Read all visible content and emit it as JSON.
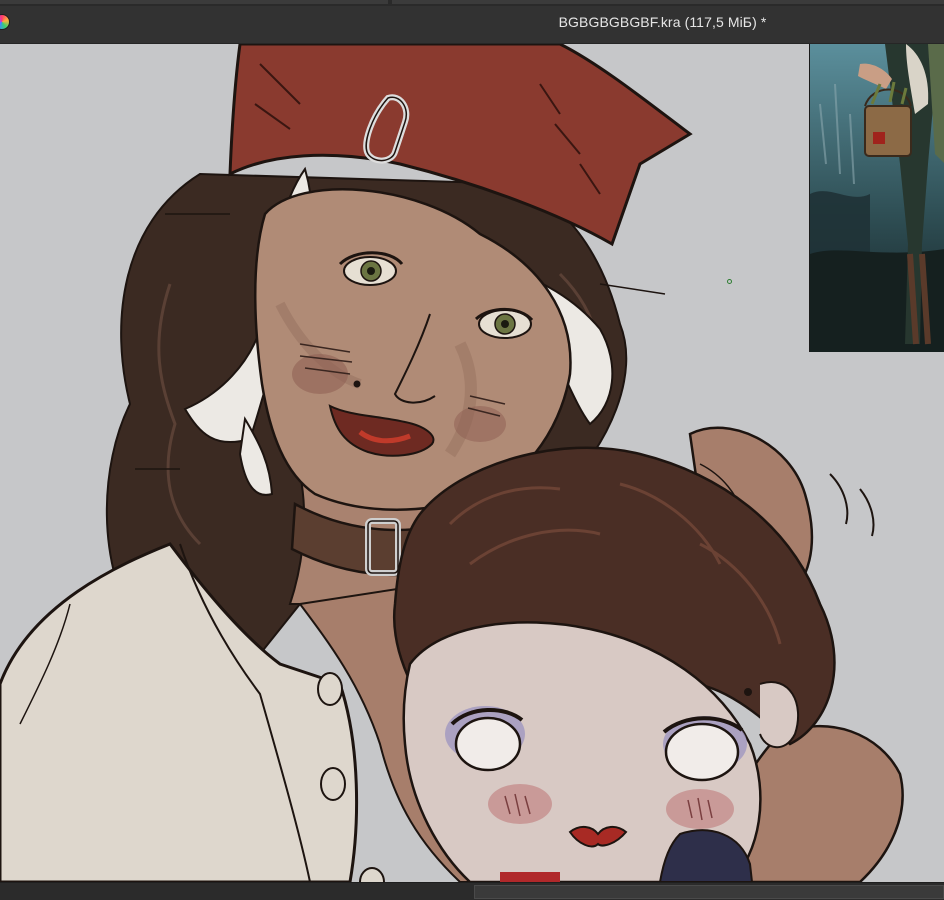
{
  "window": {
    "title": "BGBGBGBGBF.kra (117,5 МіБ) *"
  },
  "icons": {
    "app": "krita-app-icon"
  },
  "colors": {
    "titlebar_bg": "#323232",
    "canvas_bg": "#c6c7c9",
    "title_text": "#e6e6e6"
  }
}
